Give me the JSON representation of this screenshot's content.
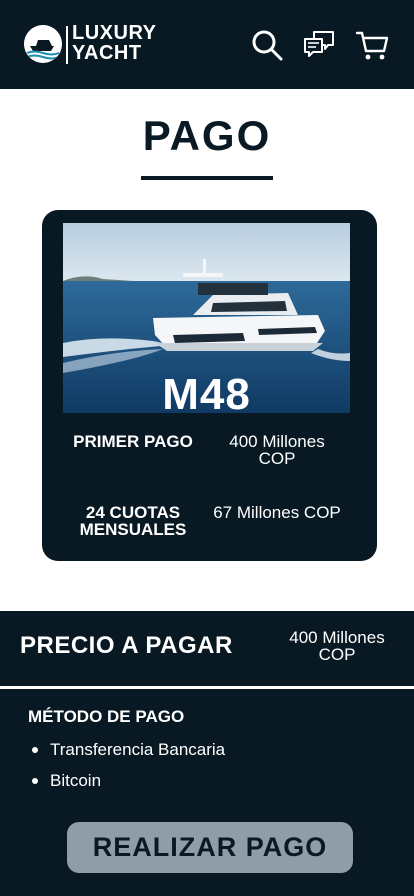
{
  "header": {
    "logo_line1": "LUXURY",
    "logo_line2": "YACHT",
    "icons": [
      "search-icon",
      "chat-icon",
      "cart-icon"
    ]
  },
  "page": {
    "title": "PAGO"
  },
  "yacht": {
    "model": "M48",
    "first_payment_label": "PRIMER PAGO",
    "first_payment_value": "400 Millones COP",
    "installments_label": "24 CUOTAS MENSUALES",
    "installments_value": "67 Millones COP"
  },
  "summary": {
    "price_label": "PRECIO A PAGAR",
    "price_value": "400 Millones COP",
    "method_title": "MÉTODO DE PAGO",
    "methods": [
      "Transferencia Bancaria",
      "Bitcoin"
    ],
    "pay_button": "REALIZAR PAGO"
  },
  "colors": {
    "navy": "#081923",
    "button": "#8f9ea6",
    "white": "#ffffff"
  }
}
